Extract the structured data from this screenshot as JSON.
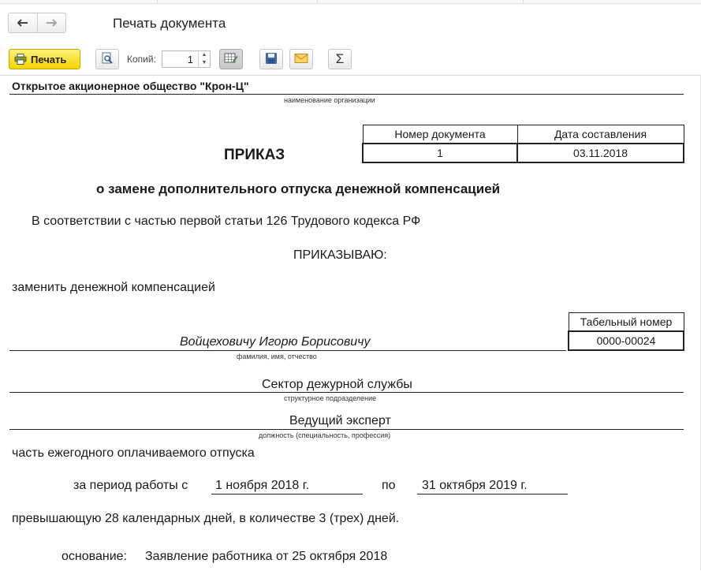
{
  "window": {
    "title": "Печать документа"
  },
  "nav": {
    "back_glyph": "🡐",
    "forward_glyph": "🡒"
  },
  "toolbar": {
    "print_label": "Печать",
    "copies_label": "Копий:",
    "copies_value": "1",
    "sum_glyph": "Σ"
  },
  "document": {
    "organization": "Открытое акционерное общество \"Крон-Ц\"",
    "organization_caption": "наименование организации",
    "doc_table": {
      "headers": [
        "Номер документа",
        "Дата составления"
      ],
      "values": [
        "1",
        "03.11.2018"
      ]
    },
    "heading": "ПРИКАЗ",
    "subheading": "о замене дополнительного отпуска денежной компенсацией",
    "basis_line": "В соответствии с частью первой статьи 126 Трудового кодекса РФ",
    "order_word": "ПРИКАЗЫВАЮ:",
    "replace_line": "заменить денежной компенсацией",
    "tab_number_header": "Табельный номер",
    "tab_number_value": "0000-00024",
    "employee_name": "Войцеховичу Игорю Борисовичу",
    "employee_caption": "фамилия, имя, отчество",
    "department": "Сектор дежурной службы",
    "department_caption": "структурное подразделение",
    "position": "Ведущий эксперт",
    "position_caption": "должность (специальность, профессия)",
    "vacation_line": "часть ежегодного оплачиваемого отпуска",
    "period_prefix": "за период работы с",
    "period_from": "1 ноября 2018 г.",
    "period_to_word": "по",
    "period_to": "31 октября 2019 г.",
    "exceeding_line": "превышающую 28 календарных дней, в количестве 3 (трех) дней.",
    "reason_label": "основание:",
    "reason_value": "Заявление работника от 25 октября 2018"
  },
  "colors": {
    "print_button": "#f4d300",
    "text": "#1a1a1a",
    "rule": "#222222"
  },
  "icons": [
    "back-arrow-icon",
    "forward-arrow-icon",
    "printer-icon",
    "preview-icon",
    "edit-table-icon",
    "save-disk-icon",
    "envelope-icon",
    "sigma-icon"
  ]
}
